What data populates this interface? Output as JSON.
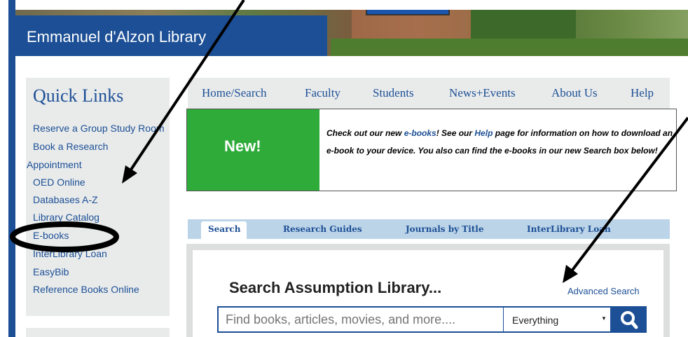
{
  "header": {
    "site_title": "Emmanuel d'Alzon Library"
  },
  "quick_links": {
    "title": "Quick Links",
    "items": [
      "Reserve a Group Study Room",
      "Book a Research",
      "Appointment",
      "OED Online",
      "Databases A-Z",
      "Library Catalog",
      "E-books",
      "InterLibrary Loan",
      "EasyBib",
      "Reference Books Online"
    ]
  },
  "nav": {
    "items": [
      "Home/Search",
      "Faculty",
      "Students",
      "News+Events",
      "About Us",
      "Help"
    ]
  },
  "banner": {
    "badge": "New!",
    "text_1": "Check out our new ",
    "link_1": "e-books",
    "text_2": "! See our ",
    "link_2": "Help",
    "text_3": " page for information on how to download an e-book to your device. You also can find the e-books in our new Search box below!"
  },
  "search_tabs": {
    "items": [
      "Search",
      "Research Guides",
      "Journals by Title",
      "InterLibrary Loan"
    ],
    "active": "Search"
  },
  "search": {
    "heading": "Search Assumption Library...",
    "advanced_link": "Advanced Search",
    "placeholder": "Find books, articles, movies, and more....",
    "scope_selected": "Everything"
  },
  "colors": {
    "brand_blue": "#1c4f95",
    "new_green": "#2fab3a",
    "panel_gray": "#e9ebeb",
    "tab_blue": "#bcd4e8"
  }
}
